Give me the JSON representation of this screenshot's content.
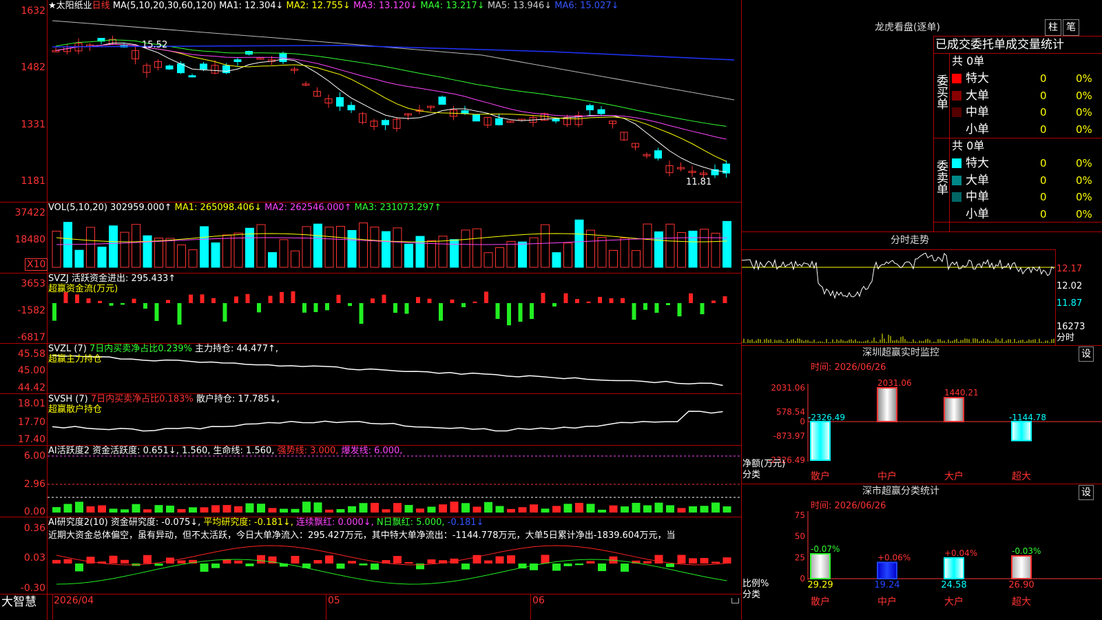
{
  "kline": {
    "stock_name": "★太阳纸业",
    "period": "日线",
    "ma_label": "MA(5,10,20,30,60,120)",
    "ma1": "MA1: 12.304↓",
    "ma2": "MA2: 12.755↓",
    "ma3": "MA3: 13.120↓",
    "ma4": "MA4: 13.217↓",
    "ma5": "MA5: 13.946↓",
    "ma6": "MA6: 15.027↓",
    "y_ticks": [
      "1632",
      "1482",
      "1331",
      "1181"
    ],
    "high_label": "15.52",
    "low_label": "11.81"
  },
  "vol": {
    "label": "VOL(5,10,20)",
    "value": "302959.000↑",
    "ma1": "MA1: 265098.406↓",
    "ma2": "MA2: 262546.000↑",
    "ma3": "MA3: 231073.297↑",
    "y_ticks": [
      "37422",
      "18480"
    ],
    "unit": "X10"
  },
  "svzj": {
    "label": "SVZJ",
    "value": "活跃资金进出: 295.433↑",
    "subtitle": "超赢资金流(万元)",
    "y_ticks": [
      "3653",
      "-1582",
      "-6817"
    ]
  },
  "svzl": {
    "label": "SVZL (7)",
    "ratio": "7日内买卖净占比0.239%",
    "hold": "主力持仓: 44.477↑,",
    "subtitle": "超赢主力持仓",
    "y_ticks": [
      "45.58",
      "45.00",
      "44.42"
    ]
  },
  "svsh": {
    "label": "SVSH (7)",
    "ratio": "7日内买卖净占比0.183%",
    "hold": "散户持仓: 17.785↓,",
    "subtitle": "超赢散户持仓",
    "y_ticks": [
      "18.01",
      "17.70",
      "17.40"
    ]
  },
  "ai_active": {
    "label": "AI活跃度2",
    "a": "资金活跃度: 0.651↓,",
    "b": "1.560,",
    "c": "生命线: 1.560,",
    "d": "强势线: 3.000,",
    "e": "爆发线: 6.000,",
    "y_ticks": [
      "6.00",
      "2.96",
      "0.00"
    ]
  },
  "ai_research": {
    "label": "AI研究度2(10)",
    "a": "资金研究度: -0.075↓,",
    "b": "平均研究度: -0.181↓,",
    "c": "连续飘红: 0.000↓,",
    "d": "N日飘红: 5.000,",
    "e": "-0.181↓",
    "comment": "近期大资金总体偏空，虽有异动，但不太活跃，今日大单净流入：295.427万元，其中特大单净流出：-1144.778万元，大单5日累计净出-1839.604万元，当",
    "y_ticks": [
      "0.36",
      "0.03",
      "-0.30"
    ]
  },
  "xaxis": {
    "brand": "大智慧",
    "d1": "2026/04",
    "d2": "05",
    "d3": "06"
  },
  "lhb": {
    "title": "龙虎看盘(逐单)",
    "btn_zhu": "柱",
    "btn_bi": "笔",
    "header": "已成交委托单成交量统计",
    "buy_side": "委买单",
    "sell_side": "委卖单",
    "buy_total": "共 0单",
    "sell_total": "共 0单",
    "buy_rows": [
      {
        "name": "特大",
        "n": "0",
        "p": "0%",
        "color": "#ff0000"
      },
      {
        "name": "大单",
        "n": "0",
        "p": "0%",
        "color": "#880000"
      },
      {
        "name": "中单",
        "n": "0",
        "p": "0%",
        "color": "#550000"
      },
      {
        "name": "小单",
        "n": "0",
        "p": "0%",
        "color": "#000000"
      }
    ],
    "sell_rows": [
      {
        "name": "特大",
        "n": "0",
        "p": "0%",
        "color": "#00ffff"
      },
      {
        "name": "大单",
        "n": "0",
        "p": "0%",
        "color": "#008888"
      },
      {
        "name": "中单",
        "n": "0",
        "p": "0%",
        "color": "#006666"
      },
      {
        "name": "小单",
        "n": "0",
        "p": "0%",
        "color": "#000000"
      }
    ]
  },
  "fenshi": {
    "title": "分时走势",
    "p1": "12.17",
    "p2": "12.02",
    "p3": "11.87",
    "vol": "16273",
    "unit": "分时"
  },
  "monitor": {
    "title": "深圳超赢实时监控",
    "btn": "设",
    "time": "时间: 2026/06/26",
    "y_ticks": [
      "2031.06",
      "578.54",
      "0",
      "-873.97",
      "-2326.49"
    ],
    "bars": [
      {
        "cat": "散户",
        "v": -2326.49,
        "label": "-2326.49"
      },
      {
        "cat": "中户",
        "v": 2031.06,
        "label": "2031.06"
      },
      {
        "cat": "大户",
        "v": 1440.21,
        "label": "1440.21"
      },
      {
        "cat": "超大",
        "v": -1144.78,
        "label": "-1144.78"
      }
    ],
    "ylabel": "净额(万元)",
    "xlabel": "分类"
  },
  "classify": {
    "title": "深市超赢分类统计",
    "btn": "设",
    "time": "时间: 2026/06/26",
    "y_ticks": [
      "75",
      "50",
      "25",
      "0"
    ],
    "bars": [
      {
        "cat": "散户",
        "v": 29.29,
        "label": "29.29",
        "chg": "-0.07%"
      },
      {
        "cat": "中户",
        "v": 19.24,
        "label": "19.24",
        "chg": "+0.06%"
      },
      {
        "cat": "大户",
        "v": 24.58,
        "label": "24.58",
        "chg": "+0.04%"
      },
      {
        "cat": "超大",
        "v": 26.9,
        "label": "26.90",
        "chg": "-0.03%"
      }
    ],
    "ylabel": "比例%",
    "xlabel": "分类"
  },
  "chart_data": [
    {
      "type": "bar",
      "title": "深圳超赢实时监控",
      "categories": [
        "散户",
        "中户",
        "大户",
        "超大"
      ],
      "values": [
        -2326.49,
        2031.06,
        1440.21,
        -1144.78
      ],
      "ylabel": "净额(万元)",
      "xlabel": "分类",
      "ylim": [
        -2326.49,
        2031.06
      ]
    },
    {
      "type": "bar",
      "title": "深市超赢分类统计",
      "categories": [
        "散户",
        "中户",
        "大户",
        "超大"
      ],
      "values": [
        29.29,
        19.24,
        24.58,
        26.9
      ],
      "ylabel": "比例%",
      "xlabel": "分类",
      "ylim": [
        0,
        75
      ]
    }
  ]
}
